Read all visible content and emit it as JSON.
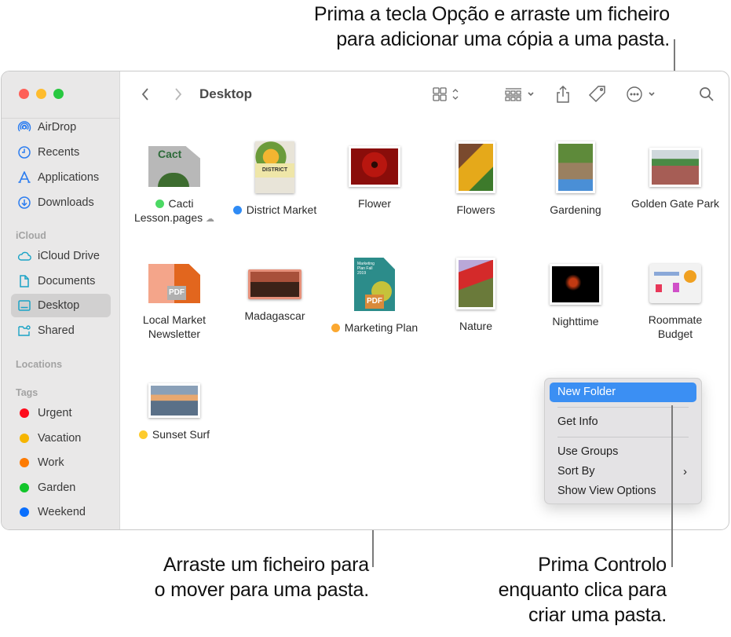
{
  "callouts": {
    "top_line1": "Prima a tecla Opção e arraste um ficheiro",
    "top_line2": "para adicionar uma cópia a uma pasta.",
    "bottom_left_line1": "Arraste um ficheiro para",
    "bottom_left_line2": "o mover para uma pasta.",
    "bottom_right_line1": "Prima Controlo",
    "bottom_right_line2": "enquanto clica para",
    "bottom_right_line3": "criar uma pasta."
  },
  "window": {
    "traffic_colors": {
      "close": "#fe5f57",
      "minimize": "#febc2e",
      "zoom": "#28c840"
    },
    "title": "Desktop"
  },
  "sidebar": {
    "favorites": [
      {
        "label": "AirDrop",
        "icon": "airdrop-icon"
      },
      {
        "label": "Recents",
        "icon": "clock-icon"
      },
      {
        "label": "Applications",
        "icon": "applications-icon"
      },
      {
        "label": "Downloads",
        "icon": "download-icon"
      }
    ],
    "icloud_header": "iCloud",
    "icloud": [
      {
        "label": "iCloud Drive",
        "icon": "cloud-icon"
      },
      {
        "label": "Documents",
        "icon": "document-icon"
      },
      {
        "label": "Desktop",
        "icon": "desktop-icon",
        "selected": true
      },
      {
        "label": "Shared",
        "icon": "shared-folder-icon"
      }
    ],
    "locations_header": "Locations",
    "tags_header": "Tags",
    "tags": [
      {
        "label": "Urgent",
        "color": "#fe0b1b"
      },
      {
        "label": "Vacation",
        "color": "#f6b500"
      },
      {
        "label": "Work",
        "color": "#fd7a00"
      },
      {
        "label": "Garden",
        "color": "#12c52a"
      },
      {
        "label": "Weekend",
        "color": "#0a6ffd"
      }
    ]
  },
  "toolbar": {
    "back": "back-icon",
    "forward": "forward-icon",
    "view": "icon-view-icon",
    "group": "group-icon",
    "share": "share-icon",
    "tag": "tag-icon",
    "more": "more-icon",
    "search": "search-icon"
  },
  "files": [
    {
      "name_line1": "Cacti",
      "name_line2": "Lesson.pages",
      "tag": "#4cd964",
      "cloud": true
    },
    {
      "name_line1": "District Market",
      "tag": "#2f8bf5"
    },
    {
      "name_line1": "Flower"
    },
    {
      "name_line1": "Flowers"
    },
    {
      "name_line1": "Gardening"
    },
    {
      "name_line1": "Golden Gate Park"
    },
    {
      "name_line1": "Local Market",
      "name_line2": "Newsletter"
    },
    {
      "name_line1": "Madagascar"
    },
    {
      "name_line1": "Marketing Plan",
      "tag": "#fba830"
    },
    {
      "name_line1": "Nature"
    },
    {
      "name_line1": "Nighttime"
    },
    {
      "name_line1": "Roommate",
      "name_line2": "Budget"
    },
    {
      "name_line1": "Sunset Surf",
      "tag": "#fdcb2d"
    }
  ],
  "thumb_text": {
    "cacti": "Cact",
    "district": "DISTRICT",
    "pdf": "PDF",
    "marketing": "Marketing Plan Fall 2019"
  },
  "context_menu": {
    "items": [
      "New Folder",
      "Get Info",
      "Use Groups",
      "Sort By",
      "Show View Options"
    ],
    "highlight": "#3b8ff3"
  }
}
